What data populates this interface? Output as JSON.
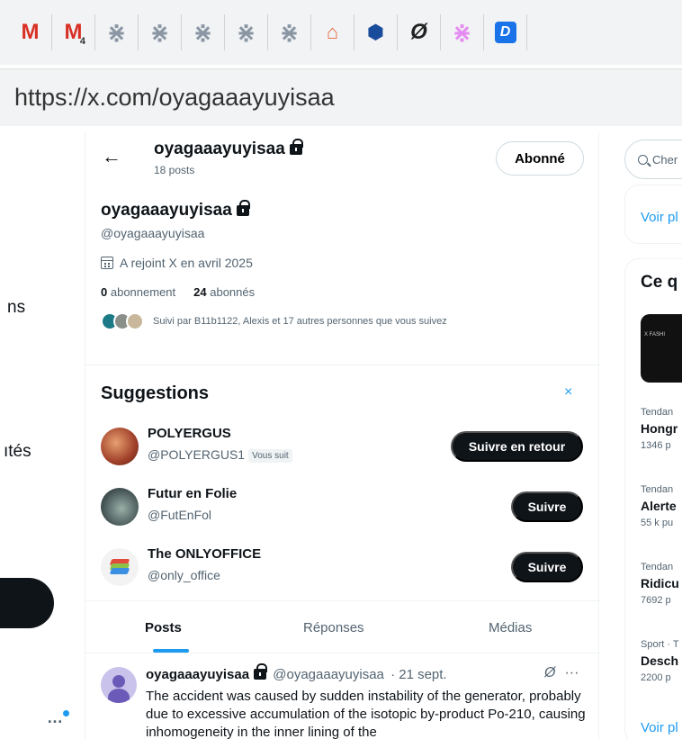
{
  "browser": {
    "bookmarks": [
      {
        "name": "gmail-icon",
        "glyph": "M",
        "sub": ""
      },
      {
        "name": "gmail-icon",
        "glyph": "M",
        "sub": "4"
      },
      {
        "name": "asterisk-icon",
        "glyph": "⋇",
        "sub": ""
      },
      {
        "name": "asterisk-icon",
        "glyph": "⋇",
        "sub": ""
      },
      {
        "name": "asterisk-icon",
        "glyph": "⋇",
        "sub": ""
      },
      {
        "name": "asterisk-icon",
        "glyph": "⋇",
        "sub": ""
      },
      {
        "name": "asterisk-icon",
        "glyph": "⋇",
        "sub": ""
      },
      {
        "name": "house-icon",
        "glyph": "⌂",
        "sub": ""
      },
      {
        "name": "shield-icon",
        "glyph": "⬢",
        "sub": ""
      },
      {
        "name": "null-icon",
        "glyph": "Ø",
        "sub": ""
      },
      {
        "name": "asterisk-pink-icon",
        "glyph": "⋇",
        "sub": ""
      },
      {
        "name": "d-icon",
        "glyph": "D",
        "sub": ""
      }
    ],
    "url": "https://x.com/oyagaaayuyisaa"
  },
  "nav": {
    "frag1": "ns",
    "frag2": "ıtés",
    "more": "…"
  },
  "header": {
    "name": "oyagaaayuyisaa",
    "posts": "18 posts",
    "follow_state": "Abonné"
  },
  "profile": {
    "name": "oyagaaayuyisaa",
    "handle": "@oyagaaayuyisaa",
    "joined": "A rejoint X en avril 2025",
    "following_count": "0",
    "following_label": "abonnement",
    "followers_count": "24",
    "followers_label": "abonnés",
    "followed_by": "Suivi par B11b1122, Alexis et 17 autres personnes que vous suivez"
  },
  "suggestions": {
    "title": "Suggestions",
    "close": "×",
    "items": [
      {
        "name": "POLYERGUS",
        "handle": "@POLYERGUS1",
        "badge": "Vous suit",
        "button": "Suivre en retour"
      },
      {
        "name": "Futur en Folie",
        "handle": "@FutEnFol",
        "badge": "",
        "button": "Suivre"
      },
      {
        "name": "The ONLYOFFICE",
        "handle": "@only_office",
        "badge": "",
        "button": "Suivre"
      }
    ]
  },
  "tabs": [
    {
      "label": "Posts",
      "active": true
    },
    {
      "label": "Réponses",
      "active": false
    },
    {
      "label": "Médias",
      "active": false
    }
  ],
  "tweet": {
    "name": "oyagaaayuyisaa",
    "handle": "@oyagaaayuyisaa",
    "date": "· 21 sept.",
    "more": "···",
    "null_glyph": "Ø",
    "text": "The accident was caused by sudden instability of the generator, probably due to excessive accumulation of the isotopic by-product Po-210, causing inhomogeneity in the inner lining of the"
  },
  "right": {
    "search_placeholder": "Cher",
    "voir_plus": "Voir pl",
    "section_title": "Ce q",
    "image_caption": "X FASHI",
    "trends": [
      {
        "label": "Tendan",
        "title": "Hongr",
        "count": "1346 p"
      },
      {
        "label": "Tendan",
        "title": "Alerte",
        "count": "55 k pu"
      },
      {
        "label": "Tendan",
        "title": "Ridicu",
        "count": "7692 p"
      },
      {
        "label": "Sport · T",
        "title": "Desch",
        "count": "2200 p"
      }
    ],
    "voir_plus_bottom": "Voir pl"
  },
  "colors": {
    "accent": "#1d9bf0",
    "text": "#0f1419",
    "muted": "#536471"
  }
}
